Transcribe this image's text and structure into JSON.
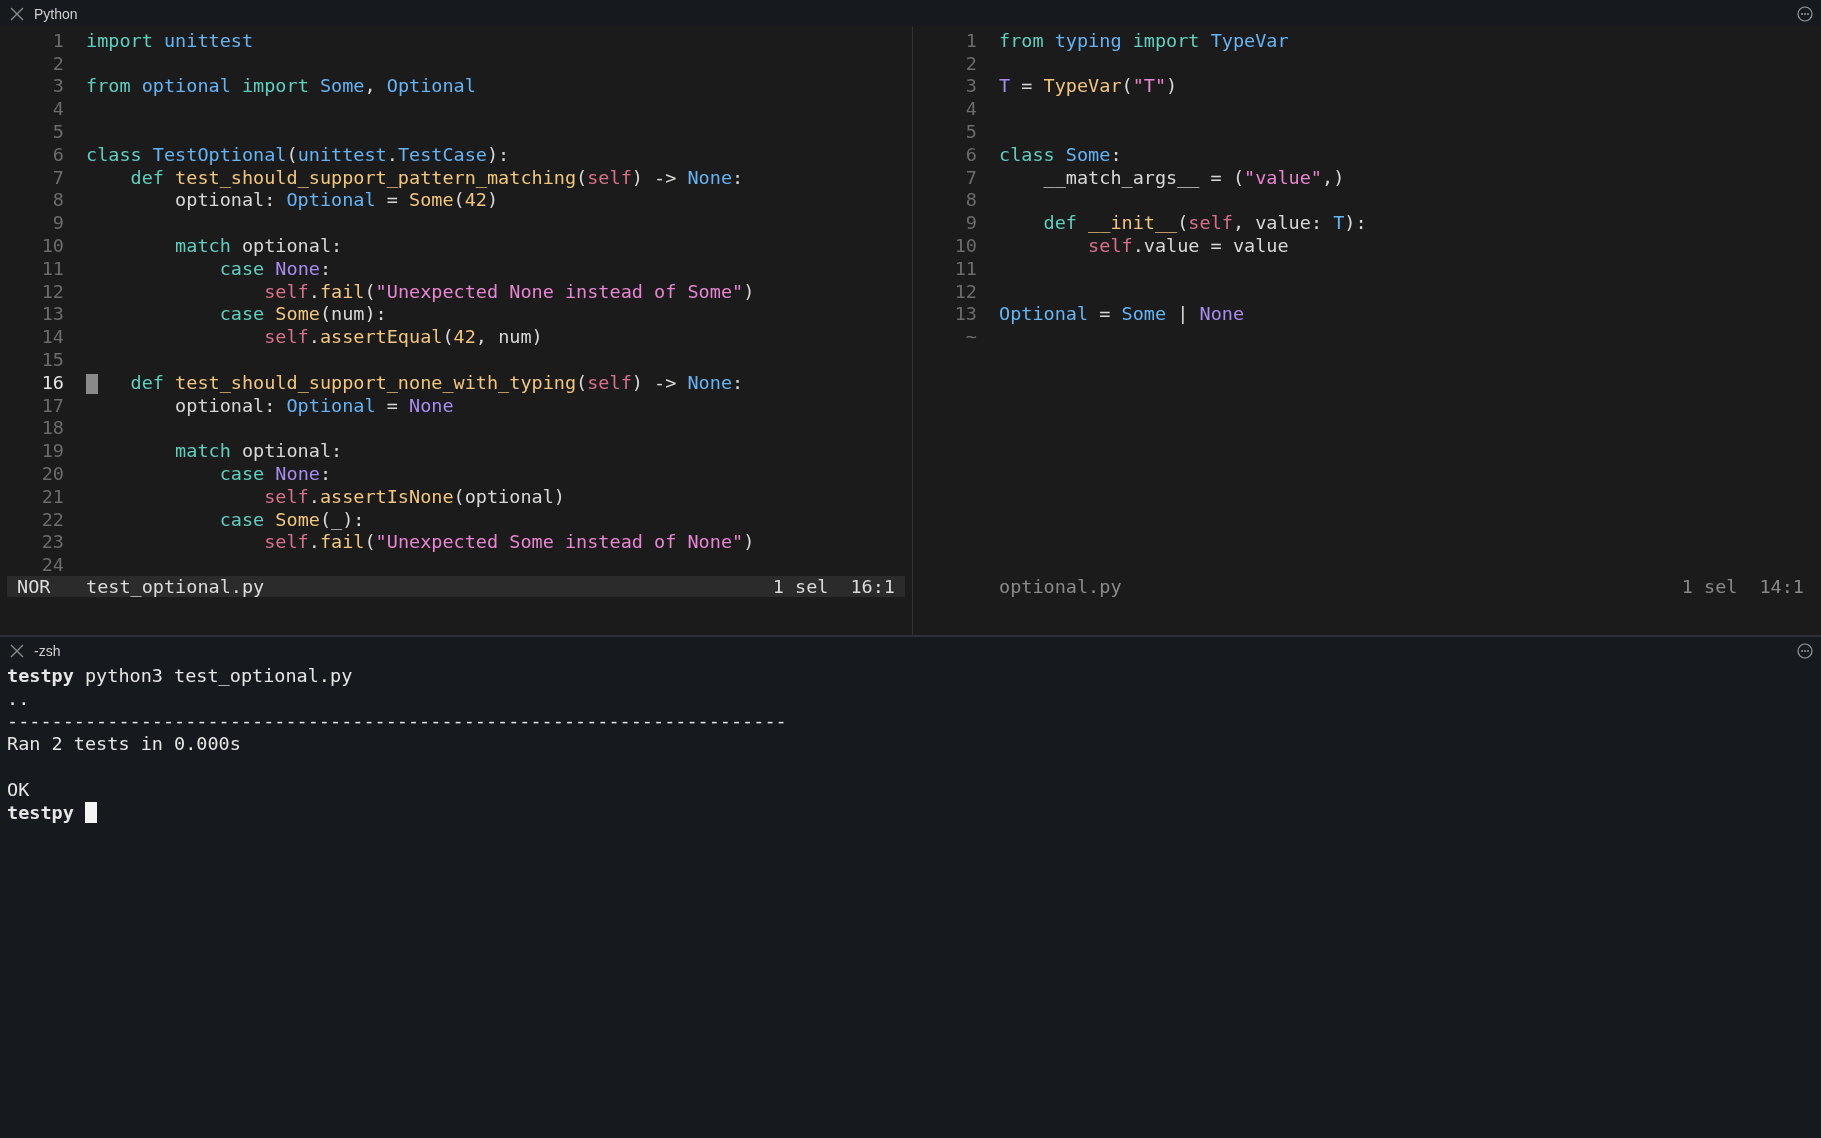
{
  "top_pane": {
    "title": "Python",
    "editors": [
      {
        "active": true,
        "lines": [
          {
            "n": "1",
            "current": false,
            "tokens": [
              {
                "text": "import ",
                "kind": "kw"
              },
              {
                "text": "unittest",
                "kind": "ty"
              }
            ]
          },
          {
            "n": "2",
            "current": false
          },
          {
            "n": "3",
            "current": false,
            "tokens": [
              {
                "text": "from ",
                "kind": "kw"
              },
              {
                "text": "optional ",
                "kind": "ty"
              },
              {
                "text": "import ",
                "kind": "kw"
              },
              {
                "text": "Some",
                "kind": "ty"
              },
              {
                "text": ", ",
                "kind": "p"
              },
              {
                "text": "Optional",
                "kind": "ty"
              }
            ]
          },
          {
            "n": "4",
            "current": false
          },
          {
            "n": "5",
            "current": false
          },
          {
            "n": "6",
            "current": false,
            "tokens": [
              {
                "text": "class ",
                "kind": "kw"
              },
              {
                "text": "TestOptional",
                "kind": "ty"
              },
              {
                "text": "(",
                "kind": "p"
              },
              {
                "text": "unittest",
                "kind": "ty"
              },
              {
                "text": ".",
                "kind": "p"
              },
              {
                "text": "TestCase",
                "kind": "ty"
              },
              {
                "text": "):",
                "kind": "p"
              }
            ]
          },
          {
            "n": "7",
            "current": false,
            "tokens": [
              {
                "text": "    def ",
                "kind": "kw"
              },
              {
                "text": "test_should_support_pattern_matching",
                "kind": "fn"
              },
              {
                "text": "(",
                "kind": "p"
              },
              {
                "text": "self",
                "kind": "self"
              },
              {
                "text": ") -> ",
                "kind": "p"
              },
              {
                "text": "None",
                "kind": "ty"
              },
              {
                "text": ":",
                "kind": "p"
              }
            ]
          },
          {
            "n": "8",
            "current": false,
            "tokens": [
              {
                "text": "        optional: ",
                "kind": "p"
              },
              {
                "text": "Optional",
                "kind": "ty"
              },
              {
                "text": " = ",
                "kind": "p"
              },
              {
                "text": "Some",
                "kind": "fn"
              },
              {
                "text": "(",
                "kind": "p"
              },
              {
                "text": "42",
                "kind": "num"
              },
              {
                "text": ")",
                "kind": "p"
              }
            ]
          },
          {
            "n": "9",
            "current": false
          },
          {
            "n": "10",
            "current": false,
            "tokens": [
              {
                "text": "        match",
                "kind": "kw"
              },
              {
                "text": " optional:",
                "kind": "p"
              }
            ]
          },
          {
            "n": "11",
            "current": false,
            "tokens": [
              {
                "text": "            case ",
                "kind": "kw"
              },
              {
                "text": "None",
                "kind": "none"
              },
              {
                "text": ":",
                "kind": "p"
              }
            ]
          },
          {
            "n": "12",
            "current": false,
            "tokens": [
              {
                "text": "                self",
                "kind": "self"
              },
              {
                "text": ".",
                "kind": "p"
              },
              {
                "text": "fail",
                "kind": "fn"
              },
              {
                "text": "(",
                "kind": "p"
              },
              {
                "text": "\"Unexpected None instead of Some\"",
                "kind": "str"
              },
              {
                "text": ")",
                "kind": "p"
              }
            ]
          },
          {
            "n": "13",
            "current": false,
            "tokens": [
              {
                "text": "            case ",
                "kind": "kw"
              },
              {
                "text": "Some",
                "kind": "fn"
              },
              {
                "text": "(num):",
                "kind": "p"
              }
            ]
          },
          {
            "n": "14",
            "current": false,
            "tokens": [
              {
                "text": "                self",
                "kind": "self"
              },
              {
                "text": ".",
                "kind": "p"
              },
              {
                "text": "assertEqual",
                "kind": "fn"
              },
              {
                "text": "(",
                "kind": "p"
              },
              {
                "text": "42",
                "kind": "num"
              },
              {
                "text": ", num)",
                "kind": "p"
              }
            ]
          },
          {
            "n": "15",
            "current": false
          },
          {
            "n": "16",
            "current": true,
            "tokens": [
              {
                "text": "    def ",
                "kind": "kw"
              },
              {
                "text": "test_should_support_none_with_typing",
                "kind": "fn"
              },
              {
                "text": "(",
                "kind": "p"
              },
              {
                "text": "self",
                "kind": "self"
              },
              {
                "text": ") -> ",
                "kind": "p"
              },
              {
                "text": "None",
                "kind": "ty"
              },
              {
                "text": ":",
                "kind": "p"
              }
            ]
          },
          {
            "n": "17",
            "current": false,
            "tokens": [
              {
                "text": "        optional: ",
                "kind": "p"
              },
              {
                "text": "Optional",
                "kind": "ty"
              },
              {
                "text": " = ",
                "kind": "p"
              },
              {
                "text": "None",
                "kind": "none"
              }
            ]
          },
          {
            "n": "18",
            "current": false
          },
          {
            "n": "19",
            "current": false,
            "tokens": [
              {
                "text": "        match",
                "kind": "kw"
              },
              {
                "text": " optional:",
                "kind": "p"
              }
            ]
          },
          {
            "n": "20",
            "current": false,
            "tokens": [
              {
                "text": "            case ",
                "kind": "kw"
              },
              {
                "text": "None",
                "kind": "none"
              },
              {
                "text": ":",
                "kind": "p"
              }
            ]
          },
          {
            "n": "21",
            "current": false,
            "tokens": [
              {
                "text": "                self",
                "kind": "self"
              },
              {
                "text": ".",
                "kind": "p"
              },
              {
                "text": "assertIsNone",
                "kind": "fn"
              },
              {
                "text": "(optional)",
                "kind": "p"
              }
            ]
          },
          {
            "n": "22",
            "current": false,
            "tokens": [
              {
                "text": "            case ",
                "kind": "kw"
              },
              {
                "text": "Some",
                "kind": "fn"
              },
              {
                "text": "(_):",
                "kind": "p"
              }
            ]
          },
          {
            "n": "23",
            "current": false,
            "tokens": [
              {
                "text": "                self",
                "kind": "self"
              },
              {
                "text": ".",
                "kind": "p"
              },
              {
                "text": "fail",
                "kind": "fn"
              },
              {
                "text": "(",
                "kind": "p"
              },
              {
                "text": "\"Unexpected Some instead of None\"",
                "kind": "str"
              },
              {
                "text": ")",
                "kind": "p"
              }
            ]
          },
          {
            "n": "24",
            "current": false
          }
        ],
        "status": {
          "mode": "NOR",
          "file": "test_optional.py",
          "selection": "1 sel",
          "position": "16:1"
        }
      },
      {
        "active": false,
        "lines": [
          {
            "n": "1",
            "current": false,
            "tokens": [
              {
                "text": "from ",
                "kind": "kw"
              },
              {
                "text": "typing ",
                "kind": "ty"
              },
              {
                "text": "import ",
                "kind": "kw"
              },
              {
                "text": "TypeVar",
                "kind": "ty"
              }
            ]
          },
          {
            "n": "2",
            "current": false
          },
          {
            "n": "3",
            "current": false,
            "tokens": [
              {
                "text": "T",
                "kind": "none"
              },
              {
                "text": " = ",
                "kind": "p"
              },
              {
                "text": "TypeVar",
                "kind": "fn"
              },
              {
                "text": "(",
                "kind": "p"
              },
              {
                "text": "\"T\"",
                "kind": "str"
              },
              {
                "text": ")",
                "kind": "p"
              }
            ]
          },
          {
            "n": "4",
            "current": false
          },
          {
            "n": "5",
            "current": false
          },
          {
            "n": "6",
            "current": false,
            "tokens": [
              {
                "text": "class ",
                "kind": "kw"
              },
              {
                "text": "Some",
                "kind": "ty"
              },
              {
                "text": ":",
                "kind": "p"
              }
            ]
          },
          {
            "n": "7",
            "current": false,
            "tokens": [
              {
                "text": "    __match_args__ = (",
                "kind": "p"
              },
              {
                "text": "\"value\"",
                "kind": "str"
              },
              {
                "text": ",)",
                "kind": "p"
              }
            ]
          },
          {
            "n": "8",
            "current": false
          },
          {
            "n": "9",
            "current": false,
            "tokens": [
              {
                "text": "    def ",
                "kind": "kw"
              },
              {
                "text": "__init__",
                "kind": "fn"
              },
              {
                "text": "(",
                "kind": "p"
              },
              {
                "text": "self",
                "kind": "self"
              },
              {
                "text": ", value: ",
                "kind": "p"
              },
              {
                "text": "T",
                "kind": "ty"
              },
              {
                "text": "):",
                "kind": "p"
              }
            ]
          },
          {
            "n": "10",
            "current": false,
            "tokens": [
              {
                "text": "        self",
                "kind": "self"
              },
              {
                "text": ".value = value",
                "kind": "p"
              }
            ]
          },
          {
            "n": "11",
            "current": false
          },
          {
            "n": "12",
            "current": false
          },
          {
            "n": "13",
            "current": false,
            "tokens": [
              {
                "text": "Optional",
                "kind": "ty"
              },
              {
                "text": " = ",
                "kind": "p"
              },
              {
                "text": "Some",
                "kind": "ty"
              },
              {
                "text": " | ",
                "kind": "p"
              },
              {
                "text": "None",
                "kind": "none"
              }
            ]
          }
        ],
        "end_marker": "~",
        "status": {
          "file": "optional.py",
          "selection": "1 sel",
          "position": "14:1"
        }
      }
    ]
  },
  "terminal": {
    "title": "-zsh",
    "lines": [
      {
        "kind": "prompt",
        "prompt": "testpy",
        "text": "python3 test_optional.py",
        "cursor": false
      },
      {
        "kind": "output",
        "text": ".."
      },
      {
        "kind": "output",
        "text": "----------------------------------------------------------------------"
      },
      {
        "kind": "output",
        "text": "Ran 2 tests in 0.000s"
      },
      {
        "kind": "blank"
      },
      {
        "kind": "output",
        "text": "OK"
      },
      {
        "kind": "prompt",
        "prompt": "testpy",
        "cursor": true
      }
    ]
  }
}
